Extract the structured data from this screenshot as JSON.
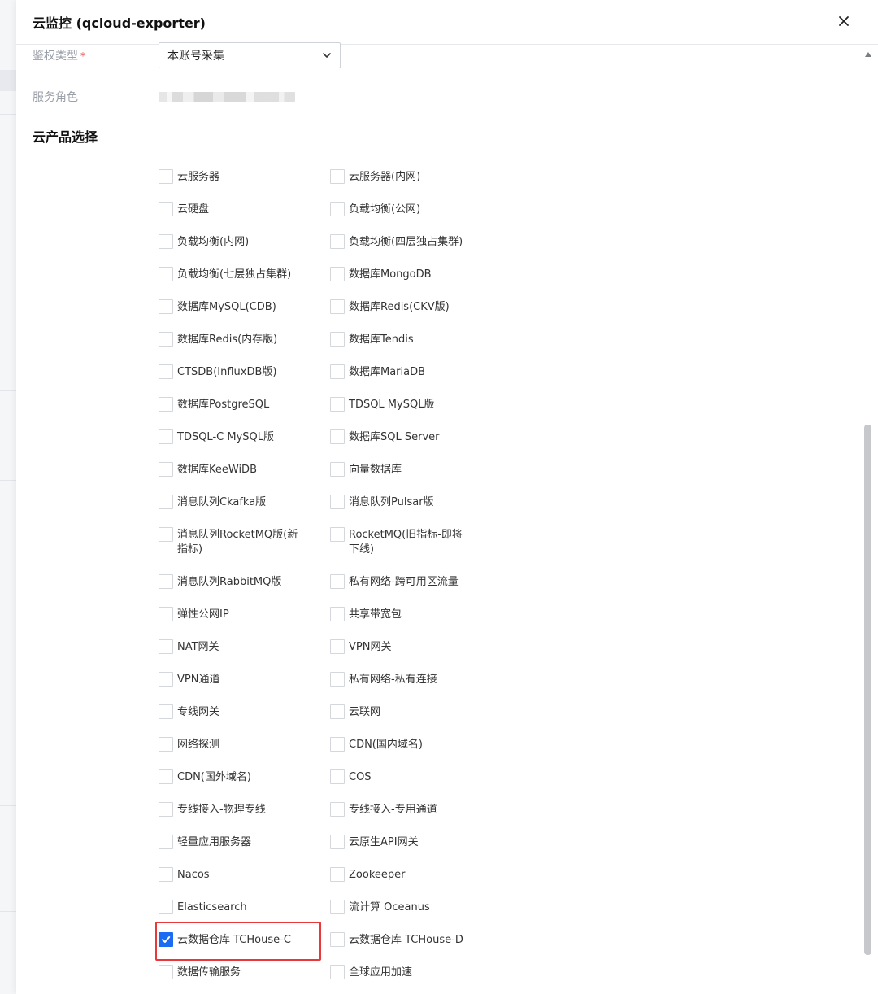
{
  "dialog": {
    "title": "云监控 (qcloud-exporter)"
  },
  "form": {
    "auth_type_label": "鉴权类型",
    "required_mark": "*",
    "auth_type_value": "本账号采集",
    "service_role_label": "服务角色"
  },
  "section": {
    "title": "云产品选择"
  },
  "products": [
    {
      "label": "云服务器",
      "checked": false
    },
    {
      "label": "云服务器(内网)",
      "checked": false
    },
    {
      "label": "云硬盘",
      "checked": false
    },
    {
      "label": "负载均衡(公网)",
      "checked": false
    },
    {
      "label": "负载均衡(内网)",
      "checked": false
    },
    {
      "label": "负载均衡(四层独占集群)",
      "checked": false
    },
    {
      "label": "负载均衡(七层独占集群)",
      "checked": false
    },
    {
      "label": "数据库MongoDB",
      "checked": false
    },
    {
      "label": "数据库MySQL(CDB)",
      "checked": false
    },
    {
      "label": "数据库Redis(CKV版)",
      "checked": false
    },
    {
      "label": "数据库Redis(内存版)",
      "checked": false
    },
    {
      "label": "数据库Tendis",
      "checked": false
    },
    {
      "label": "CTSDB(InfluxDB版)",
      "checked": false
    },
    {
      "label": "数据库MariaDB",
      "checked": false
    },
    {
      "label": "数据库PostgreSQL",
      "checked": false
    },
    {
      "label": "TDSQL MySQL版",
      "checked": false
    },
    {
      "label": "TDSQL-C MySQL版",
      "checked": false
    },
    {
      "label": "数据库SQL Server",
      "checked": false
    },
    {
      "label": "数据库KeeWiDB",
      "checked": false
    },
    {
      "label": "向量数据库",
      "checked": false
    },
    {
      "label": "消息队列Ckafka版",
      "checked": false
    },
    {
      "label": "消息队列Pulsar版",
      "checked": false
    },
    {
      "label": "消息队列RocketMQ版(新指标)",
      "checked": false
    },
    {
      "label": "RocketMQ(旧指标-即将下线)",
      "checked": false
    },
    {
      "label": "消息队列RabbitMQ版",
      "checked": false
    },
    {
      "label": "私有网络-跨可用区流量",
      "checked": false
    },
    {
      "label": "弹性公网IP",
      "checked": false
    },
    {
      "label": "共享带宽包",
      "checked": false
    },
    {
      "label": "NAT网关",
      "checked": false
    },
    {
      "label": "VPN网关",
      "checked": false
    },
    {
      "label": "VPN通道",
      "checked": false
    },
    {
      "label": "私有网络-私有连接",
      "checked": false
    },
    {
      "label": "专线网关",
      "checked": false
    },
    {
      "label": "云联网",
      "checked": false
    },
    {
      "label": "网络探测",
      "checked": false
    },
    {
      "label": "CDN(国内域名)",
      "checked": false
    },
    {
      "label": "CDN(国外域名)",
      "checked": false
    },
    {
      "label": "COS",
      "checked": false
    },
    {
      "label": "专线接入-物理专线",
      "checked": false
    },
    {
      "label": "专线接入-专用通道",
      "checked": false
    },
    {
      "label": "轻量应用服务器",
      "checked": false
    },
    {
      "label": "云原生API网关",
      "checked": false
    },
    {
      "label": "Nacos",
      "checked": false
    },
    {
      "label": "Zookeeper",
      "checked": false
    },
    {
      "label": "Elasticsearch",
      "checked": false
    },
    {
      "label": "流计算 Oceanus",
      "checked": false
    },
    {
      "label": "云数据仓库 TCHouse-C",
      "checked": true
    },
    {
      "label": "云数据仓库 TCHouse-D",
      "checked": false
    },
    {
      "label": "数据传输服务",
      "checked": false
    },
    {
      "label": "全球应用加速",
      "checked": false
    }
  ],
  "colors": {
    "checkbox_checked": "#1c6cf3",
    "highlight_border": "#e8383b",
    "required": "#e54545"
  }
}
